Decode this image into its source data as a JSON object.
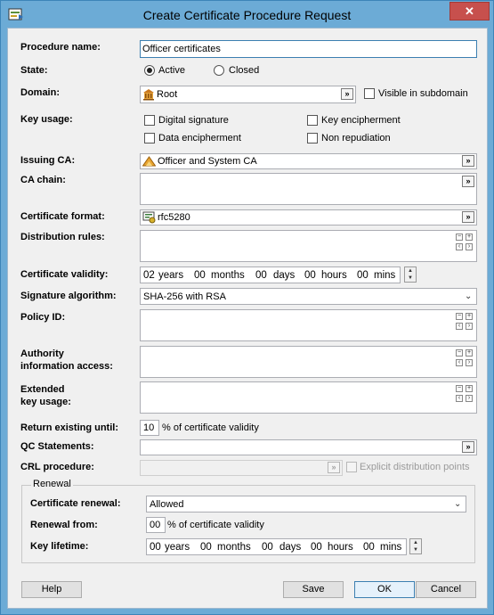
{
  "window": {
    "title": "Create Certificate Procedure Request",
    "close_label": "✕"
  },
  "labels": {
    "procedure_name": "Procedure name:",
    "state": "State:",
    "domain": "Domain:",
    "key_usage": "Key usage:",
    "issuing_ca": "Issuing CA:",
    "ca_chain": "CA chain:",
    "certificate_format": "Certificate format:",
    "distribution_rules": "Distribution rules:",
    "certificate_validity": "Certificate validity:",
    "signature_algorithm": "Signature algorithm:",
    "policy_id": "Policy ID:",
    "authority_info_1": "Authority",
    "authority_info_2": "information access:",
    "extended_1": "Extended",
    "extended_2": "key usage:",
    "return_existing": "Return existing until:",
    "qc_statements": "QC Statements:",
    "crl_procedure": "CRL procedure:"
  },
  "fields": {
    "procedure_name": "Officer certificates",
    "domain": "Root",
    "issuing_ca": "Officer and System CA",
    "certificate_format": "rfc5280",
    "signature_algorithm": "SHA-256 with RSA",
    "return_existing_value": "10",
    "return_existing_suffix": "% of certificate validity"
  },
  "state_options": {
    "active": "Active",
    "closed": "Closed",
    "selected": "Active"
  },
  "visible_in_subdomain": "Visible in subdomain",
  "key_usage_options": {
    "digital_signature": "Digital signature",
    "key_encipherment": "Key encipherment",
    "data_encipherment": "Data encipherment",
    "non_repudiation": "Non repudiation"
  },
  "validity": {
    "years_val": "02",
    "years": "years",
    "months_val": "00",
    "months": "months",
    "days_val": "00",
    "days": "days",
    "hours_val": "00",
    "hours": "hours",
    "mins_val": "00",
    "mins": "mins"
  },
  "explicit_distribution_points": "Explicit distribution points",
  "renewal": {
    "group_title": "Renewal",
    "certificate_renewal_label": "Certificate renewal:",
    "certificate_renewal_value": "Allowed",
    "renewal_from_label": "Renewal from:",
    "renewal_from_value": "00",
    "renewal_from_suffix": "% of certificate validity",
    "key_lifetime_label": "Key lifetime:",
    "kl": {
      "years_val": "00",
      "years": "years",
      "months_val": "00",
      "months": "months",
      "days_val": "00",
      "days": "days",
      "hours_val": "00",
      "hours": "hours",
      "mins_val": "00",
      "mins": "mins"
    }
  },
  "buttons": {
    "help": "Help",
    "save": "Save",
    "ok": "OK",
    "cancel": "Cancel"
  },
  "icons": {
    "app": "app-icon",
    "domain": "bank-building-icon",
    "ca": "ca-pyramid-icon",
    "format": "certificate-format-icon",
    "browse": "browse-double-arrow-icon"
  }
}
